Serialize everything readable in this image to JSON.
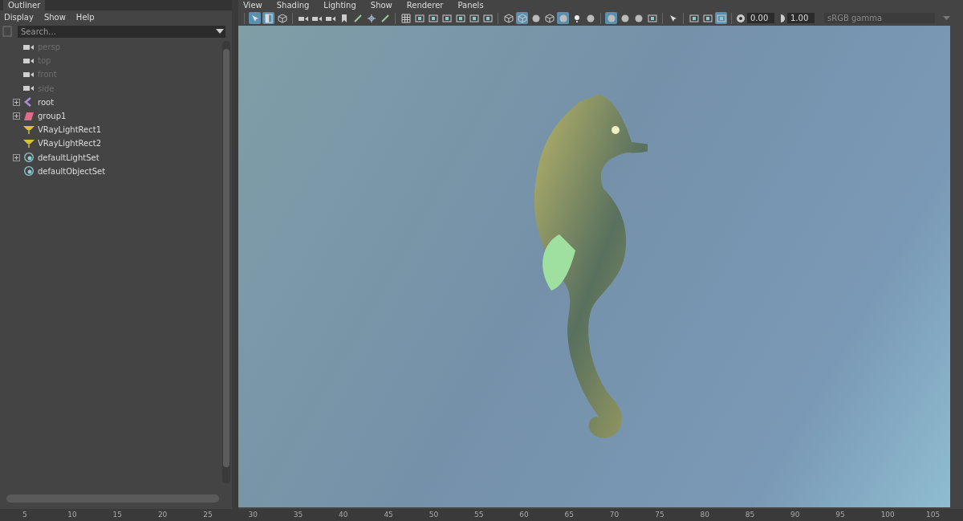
{
  "outliner": {
    "title": "Outliner",
    "menu": [
      "Display",
      "Show",
      "Help"
    ],
    "search": {
      "placeholder": "Search..."
    },
    "items": [
      {
        "label": "persp",
        "kind": "camera",
        "disabled": true,
        "expandable": false
      },
      {
        "label": "top",
        "kind": "camera",
        "disabled": true,
        "expandable": false
      },
      {
        "label": "front",
        "kind": "camera",
        "disabled": true,
        "expandable": false
      },
      {
        "label": "side",
        "kind": "camera",
        "disabled": true,
        "expandable": false
      },
      {
        "label": "root",
        "kind": "joint",
        "disabled": false,
        "expandable": true
      },
      {
        "label": "group1",
        "kind": "group",
        "disabled": false,
        "expandable": true
      },
      {
        "label": "VRayLightRect1",
        "kind": "light",
        "disabled": false,
        "expandable": false
      },
      {
        "label": "VRayLightRect2",
        "kind": "light",
        "disabled": false,
        "expandable": false
      },
      {
        "label": "defaultLightSet",
        "kind": "set",
        "disabled": false,
        "expandable": true
      },
      {
        "label": "defaultObjectSet",
        "kind": "set",
        "disabled": false,
        "expandable": false
      }
    ]
  },
  "viewport": {
    "menu": [
      "View",
      "Shading",
      "Lighting",
      "Show",
      "Renderer",
      "Panels"
    ],
    "toolbar": [
      [
        {
          "kind": "select",
          "selected": true
        },
        {
          "kind": "panel",
          "selected": true
        },
        {
          "kind": "cube",
          "selected": false
        }
      ],
      [
        {
          "kind": "camera",
          "selected": false
        },
        {
          "kind": "camera",
          "selected": false
        },
        {
          "kind": "camera",
          "selected": false
        },
        {
          "kind": "bookmark",
          "selected": false
        },
        {
          "kind": "pen",
          "selected": false
        },
        {
          "kind": "move",
          "selected": false
        },
        {
          "kind": "pen",
          "selected": false
        }
      ],
      [
        {
          "kind": "grid",
          "selected": false
        },
        {
          "kind": "frame",
          "selected": false
        },
        {
          "kind": "frame",
          "selected": false
        },
        {
          "kind": "frame",
          "selected": false
        },
        {
          "kind": "frame",
          "selected": false
        },
        {
          "kind": "frame",
          "selected": false
        },
        {
          "kind": "frame",
          "selected": false
        }
      ],
      [
        {
          "kind": "cube",
          "selected": false
        },
        {
          "kind": "cube",
          "selected": true
        },
        {
          "kind": "sphere",
          "selected": false
        },
        {
          "kind": "cube",
          "selected": false
        },
        {
          "kind": "sphere",
          "selected": true
        },
        {
          "kind": "light",
          "selected": false
        },
        {
          "kind": "sphere",
          "selected": false
        }
      ],
      [
        {
          "kind": "sphere",
          "selected": true
        },
        {
          "kind": "sphere",
          "selected": false
        },
        {
          "kind": "sphere",
          "selected": false
        },
        {
          "kind": "frame",
          "selected": false
        }
      ],
      [
        {
          "kind": "select",
          "selected": false
        }
      ],
      [
        {
          "kind": "frame",
          "selected": false
        },
        {
          "kind": "frame",
          "selected": false
        },
        {
          "kind": "frame",
          "selected": true
        }
      ]
    ],
    "exposure": "0.00",
    "gamma": "1.00",
    "color_space": {
      "value": "sRGB gamma",
      "disabled": true
    }
  },
  "timeline": {
    "ticks": [
      "5",
      "10",
      "15",
      "20",
      "25",
      "30",
      "35",
      "40",
      "45",
      "50",
      "55",
      "60",
      "65",
      "70",
      "75",
      "80",
      "85",
      "90",
      "95",
      "100",
      "105"
    ]
  }
}
